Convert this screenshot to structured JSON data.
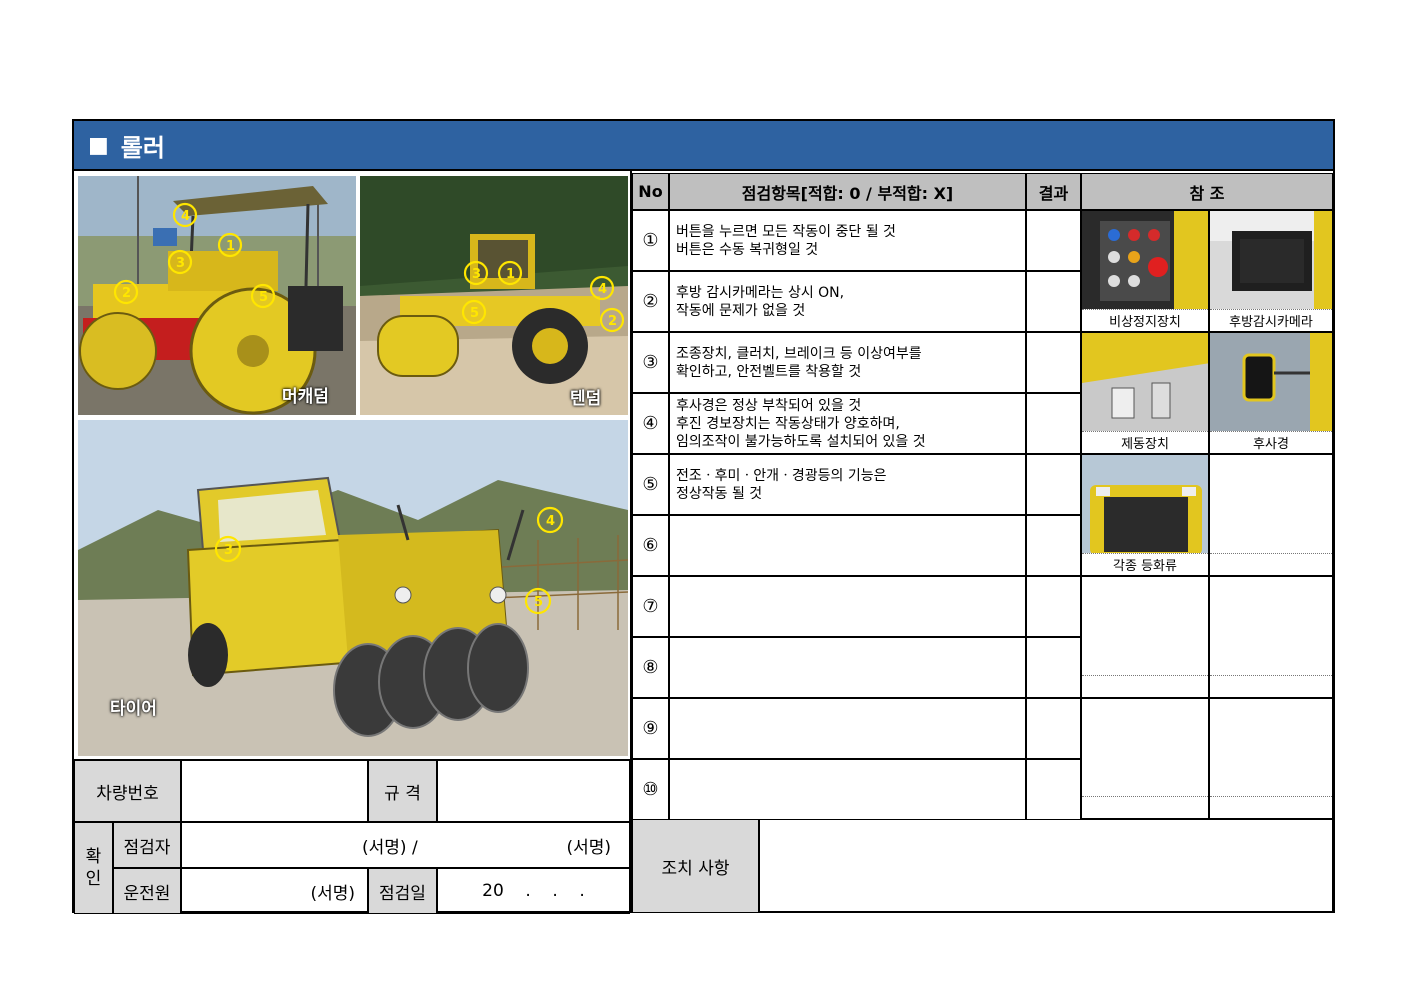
{
  "title": "롤러",
  "title_marker": "■",
  "photos": {
    "macadam_label": "머캐덤",
    "tandem_label": "텐덤",
    "tire_label": "타이어"
  },
  "info": {
    "vehicle_no_label": "차량번호",
    "spec_label": "규  격",
    "confirm_label": "확\n인",
    "inspector_label": "점검자",
    "inspector_sign": "(서명) /",
    "inspector_sign2": "(서명)",
    "driver_label": "운전원",
    "driver_sign": "(서명)",
    "date_label": "점검일",
    "date_value": "20    .    .    ."
  },
  "table": {
    "headers": {
      "no": "No",
      "item": "점검항목[적합: 0 / 부적합: X]",
      "result": "결과",
      "ref": "참  조"
    },
    "rows": [
      {
        "no": "①",
        "lines": [
          "버튼을 누르면 모든 작동이 중단 될 것",
          "버튼은 수동 복귀형일 것"
        ]
      },
      {
        "no": "②",
        "lines": [
          "후방 감시카메라는 상시 ON,",
          "작동에 문제가 없을 것"
        ]
      },
      {
        "no": "③",
        "lines": [
          "조종장치, 클러치, 브레이크 등 이상여부를",
          "확인하고, 안전벨트를 착용할 것"
        ]
      },
      {
        "no": "④",
        "lines": [
          "후사경은 정상 부착되어 있을 것",
          "후진 경보장치는 작동상태가 양호하며,",
          "임의조작이 불가능하도록 설치되어 있을 것"
        ]
      },
      {
        "no": "⑤",
        "lines": [
          "전조ㆍ후미ㆍ안개ㆍ경광등의 기능은",
          "정상작동 될 것"
        ]
      },
      {
        "no": "⑥",
        "lines": []
      },
      {
        "no": "⑦",
        "lines": []
      },
      {
        "no": "⑧",
        "lines": []
      },
      {
        "no": "⑨",
        "lines": []
      },
      {
        "no": "⑩",
        "lines": []
      }
    ],
    "refs": {
      "emergency_stop": "비상정지장치",
      "rear_camera": "후방감시카메라",
      "brake": "제동장치",
      "mirror": "후사경",
      "lights": "각종 등화류"
    }
  },
  "action": {
    "label": "조치 사항"
  },
  "colors": {
    "title_bar": "#2e62a1",
    "header_gray": "#bfbfbf",
    "label_gray": "#d9d9d9",
    "roller_yellow": "#e8d21c"
  }
}
